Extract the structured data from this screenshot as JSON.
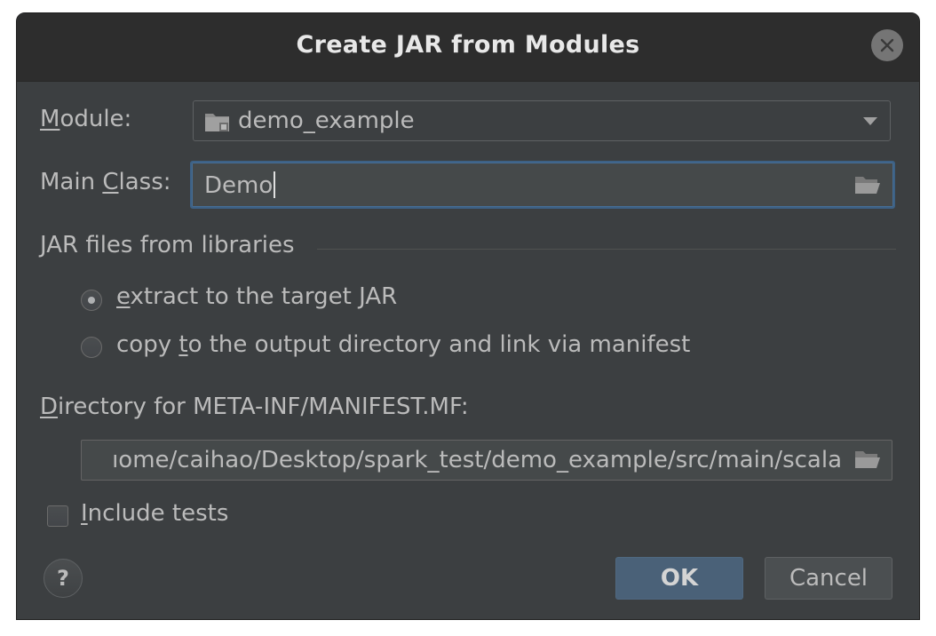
{
  "dialog": {
    "title": "Create JAR from Modules"
  },
  "module": {
    "label_mnemonic": "M",
    "label_rest": "odule:",
    "value": "demo_example",
    "icon": "folder-module-icon"
  },
  "main_class": {
    "label_prefix": "Main ",
    "label_mnemonic": "C",
    "label_rest": "lass:",
    "value": "Demo"
  },
  "libraries": {
    "section_label": "JAR files from libraries",
    "option_extract": {
      "mnemonic": "e",
      "rest": "xtract to the target JAR",
      "selected": true
    },
    "option_copy": {
      "prefix": "copy ",
      "mnemonic": "t",
      "rest": "o the output directory and link via manifest",
      "selected": false
    }
  },
  "manifest": {
    "label_mnemonic": "D",
    "label_rest": "irectory for META-INF/MANIFEST.MF:",
    "path": "ıome/caihao/Desktop/spark_test/demo_example/src/main/scala"
  },
  "include_tests": {
    "mnemonic": "I",
    "rest": "nclude tests",
    "checked": false
  },
  "buttons": {
    "help": "?",
    "ok": "OK",
    "cancel": "Cancel"
  },
  "colors": {
    "dialog_bg": "#3c3f41",
    "titlebar_bg": "#2d2d2d",
    "focus_border": "#3d6185",
    "ok_button_bg": "#4a6178",
    "text": "#bbbbbb"
  }
}
